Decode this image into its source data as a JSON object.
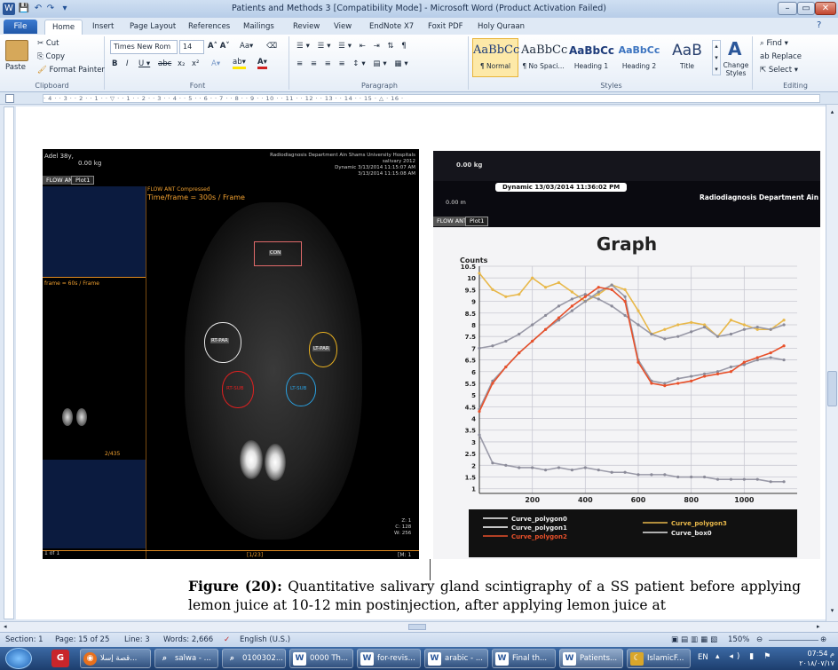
{
  "window": {
    "title": "Patients and Methods 3 [Compatibility Mode] - Microsoft Word (Product Activation Failed)"
  },
  "tabs": [
    "File",
    "Home",
    "Insert",
    "Page Layout",
    "References",
    "Mailings",
    "Review",
    "View",
    "EndNote X7",
    "Foxit PDF",
    "Holy Quraan"
  ],
  "clipboard": {
    "paste": "Paste",
    "cut": "Cut",
    "copy": "Copy",
    "format_painter": "Format Painter",
    "label": "Clipboard"
  },
  "font": {
    "name": "Times New Rom",
    "size": "14",
    "label": "Font"
  },
  "paragraph": {
    "label": "Paragraph"
  },
  "styles": {
    "label": "Styles",
    "items": [
      {
        "preview": "AaBbCc",
        "name": "¶ Normal"
      },
      {
        "preview": "AaBbCc",
        "name": "¶ No Spaci..."
      },
      {
        "preview": "AaBbCc",
        "name": "Heading 1"
      },
      {
        "preview": "AaBbCc",
        "name": "Heading 2"
      },
      {
        "preview": "AaB",
        "name": "Title"
      }
    ],
    "change": "Change Styles"
  },
  "editing": {
    "label": "Editing",
    "find": "Find",
    "replace": "Replace",
    "select": "Select"
  },
  "left_image": {
    "name_text": "Adel 38y,",
    "weight_text": "0.00 kg",
    "tab1": "FLOW ANT",
    "tab2": "Plot1",
    "dept": "Radiodiagnosis Department Ain Shams University Hospitals",
    "study": "salivary 2012",
    "dynamic": "Dynamic 3/13/2014 11:15:07 AM",
    "date2": "3/13/2014 11:15:08 AM",
    "flow_label": "FLOW ANT Compressed",
    "timeframe": "Time/frame = 300s / Frame",
    "left_frame": "frame = 60s / Frame",
    "frame_idx": "2/435",
    "page_of": "1 of 1",
    "roi_labels": [
      "CON",
      "RT-PAR",
      "LT-PAR",
      "RT-SUB",
      "LT-SUB"
    ],
    "zc": [
      "Z: 1",
      "C: 128",
      "W: 256"
    ],
    "bottom_mid": "[1/23]",
    "bottom_right": "[M: 1"
  },
  "right_image": {
    "header1": "0.00 kg",
    "dynamic": "Dynamic 13/03/2014 11:36:02 PM",
    "header2": "0.00 m",
    "dept": "Radiodiagnosis Department Ain",
    "tab1": "FLOW ANT",
    "tab2": "Plot1",
    "graph_title": "Graph",
    "legend": [
      "Curve_polygon0",
      "Curve_polygon1",
      "Curve_polygon2",
      "Curve_polygon3",
      "Curve_box0"
    ]
  },
  "chart_data": {
    "type": "line",
    "title": "Graph",
    "ylabel": "Counts",
    "ylim": [
      0,
      10.5
    ],
    "xlim": [
      0,
      1200
    ],
    "yticks": [
      "10.5",
      "10",
      "9.5",
      "9",
      "8.5",
      "8",
      "7.5",
      "7",
      "6.5",
      "6",
      "5.5",
      "5",
      "4.5",
      "4",
      "3.5",
      "3",
      "2.5",
      "2",
      "1.5",
      "1"
    ],
    "xticks": [
      "200",
      "400",
      "600",
      "800",
      "1000"
    ],
    "x": [
      0,
      50,
      100,
      150,
      200,
      250,
      300,
      350,
      400,
      450,
      500,
      550,
      600,
      650,
      700,
      750,
      800,
      850,
      900,
      950,
      1000,
      1050,
      1100,
      1150
    ],
    "series": [
      {
        "name": "Curve_polygon3",
        "color": "#e8b84a",
        "values": [
          10.2,
          9.5,
          9.2,
          9.3,
          10.0,
          9.6,
          9.8,
          9.4,
          9.0,
          9.3,
          9.7,
          9.5,
          8.6,
          7.6,
          7.8,
          8.0,
          8.1,
          8.0,
          7.5,
          8.2,
          8.0,
          7.8,
          7.8,
          8.2
        ]
      },
      {
        "name": "Curve_polygon0",
        "color": "#f2f2f2",
        "values": [
          7.0,
          7.1,
          7.3,
          7.6,
          8.0,
          8.4,
          8.8,
          9.1,
          9.3,
          9.1,
          8.8,
          8.4,
          8.0,
          7.6,
          7.4,
          7.5,
          7.7,
          7.9,
          7.5,
          7.6,
          7.8,
          7.9,
          7.8,
          8.0
        ]
      },
      {
        "name": "Curve_polygon1",
        "color": "#ffffff",
        "values": [
          4.4,
          5.6,
          6.2,
          6.8,
          7.3,
          7.8,
          8.2,
          8.6,
          9.0,
          9.4,
          9.7,
          9.2,
          6.5,
          5.6,
          5.5,
          5.7,
          5.8,
          5.9,
          6.0,
          6.2,
          6.3,
          6.5,
          6.6,
          6.5
        ]
      },
      {
        "name": "Curve_polygon2",
        "color": "#e8502a",
        "values": [
          4.3,
          5.5,
          6.2,
          6.8,
          7.3,
          7.8,
          8.3,
          8.8,
          9.2,
          9.6,
          9.5,
          9.0,
          6.4,
          5.5,
          5.4,
          5.5,
          5.6,
          5.8,
          5.9,
          6.0,
          6.4,
          6.6,
          6.8,
          7.1
        ]
      },
      {
        "name": "Curve_box0",
        "color": "#e6e6e6",
        "values": [
          3.3,
          2.1,
          2.0,
          1.9,
          1.9,
          1.8,
          1.9,
          1.8,
          1.9,
          1.8,
          1.7,
          1.7,
          1.6,
          1.6,
          1.6,
          1.5,
          1.5,
          1.5,
          1.4,
          1.4,
          1.4,
          1.4,
          1.3,
          1.3
        ]
      }
    ]
  },
  "caption": {
    "bold": "Figure (20):",
    "text": " Quantitative salivary gland scintigraphy of a SS patient before applying lemon juice at 10-12 min postinjection, after applying lemon juice at"
  },
  "status": {
    "section": "Section: 1",
    "page": "Page: 15 of 25",
    "line": "Line: 3",
    "words": "Words: 2,666",
    "lang": "English (U.S.)",
    "zoom": "150%"
  },
  "taskbar": {
    "items": [
      "قصة إسلا...",
      "salwa - ...",
      "0100302...",
      "0000 Th...",
      "for-revis...",
      "arabic - ...",
      "Final th...",
      "Patients...",
      "IslamicF..."
    ],
    "lang": "EN",
    "time": "07:54 م",
    "date": "٢٠١٨/٠٧/١٧"
  },
  "colors": {
    "accent": "#2b579a",
    "file_tab": "#1f57a8",
    "orange": "#f0a030"
  }
}
